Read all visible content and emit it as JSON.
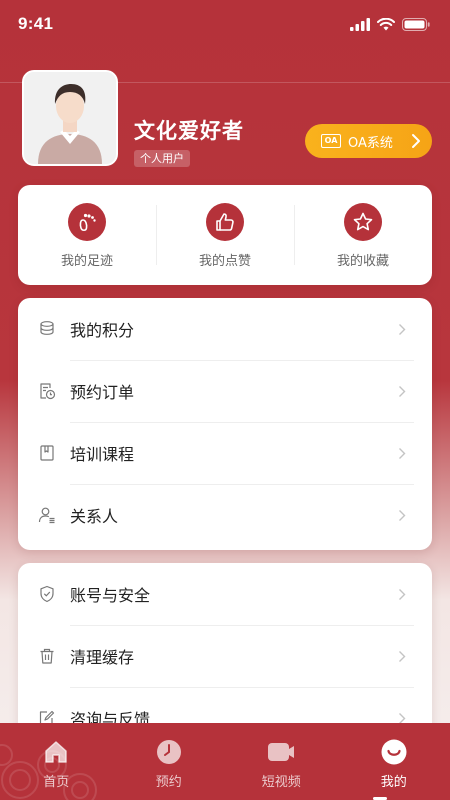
{
  "status_bar": {
    "time": "9:41"
  },
  "profile": {
    "username": "文化爱好者",
    "user_type": "个人用户",
    "oa_button_label": "OA系统",
    "oa_badge": "OA"
  },
  "quick_actions": [
    {
      "label": "我的足迹",
      "icon": "footprint-icon"
    },
    {
      "label": "我的点赞",
      "icon": "thumbs-up-icon"
    },
    {
      "label": "我的收藏",
      "icon": "star-icon"
    }
  ],
  "menu_group_1": [
    {
      "label": "我的积分",
      "icon": "coins-icon"
    },
    {
      "label": "预约订单",
      "icon": "order-clock-icon"
    },
    {
      "label": "培训课程",
      "icon": "book-icon"
    },
    {
      "label": "关系人",
      "icon": "contact-icon"
    }
  ],
  "menu_group_2": [
    {
      "label": "账号与安全",
      "icon": "shield-icon"
    },
    {
      "label": "清理缓存",
      "icon": "trash-icon"
    },
    {
      "label": "咨询与反馈",
      "icon": "feedback-icon"
    }
  ],
  "tabbar": [
    {
      "label": "首页",
      "icon": "home-icon",
      "active": false
    },
    {
      "label": "预约",
      "icon": "clock-icon",
      "active": false
    },
    {
      "label": "短视频",
      "icon": "video-icon",
      "active": false
    },
    {
      "label": "我的",
      "icon": "smile-icon",
      "active": true
    }
  ],
  "colors": {
    "primary": "#b5323a",
    "oa_button": "#f7aa18",
    "card_bg": "#ffffff"
  }
}
